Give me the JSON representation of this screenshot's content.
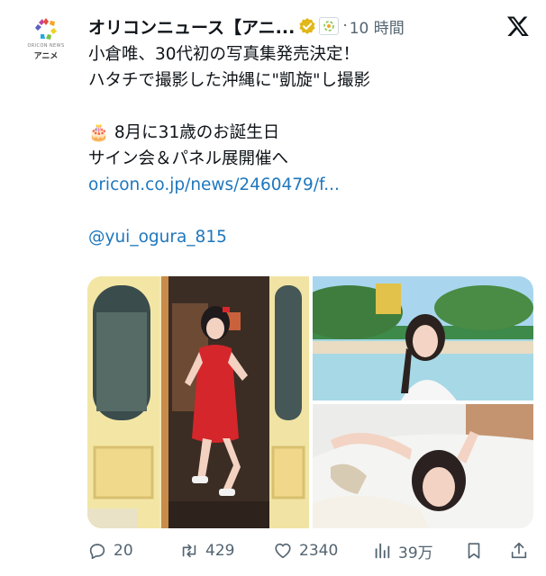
{
  "account": {
    "name": "オリコンニュース【アニ...",
    "time_sep": "·",
    "time": "10 時間",
    "avatar_brand": "ORICON NEWS",
    "avatar_sub": "アニメ"
  },
  "tweet": {
    "lines": [
      "小倉唯、30代初の写真集発売決定！",
      "ハタチで撮影した沖縄に\"凱旋\"し撮影",
      "",
      "🎂 8月に31歳のお誕生日",
      "サイン会＆パネル展開催へ"
    ],
    "link": "oricon.co.jp/news/2460479/f...",
    "mention": "@yui_ogura_815"
  },
  "actions": {
    "replies": "20",
    "reposts": "429",
    "likes": "2340",
    "views": "39万"
  },
  "colors": {
    "link": "#1d77be",
    "verified": "#e2b719",
    "muted": "#536471"
  }
}
